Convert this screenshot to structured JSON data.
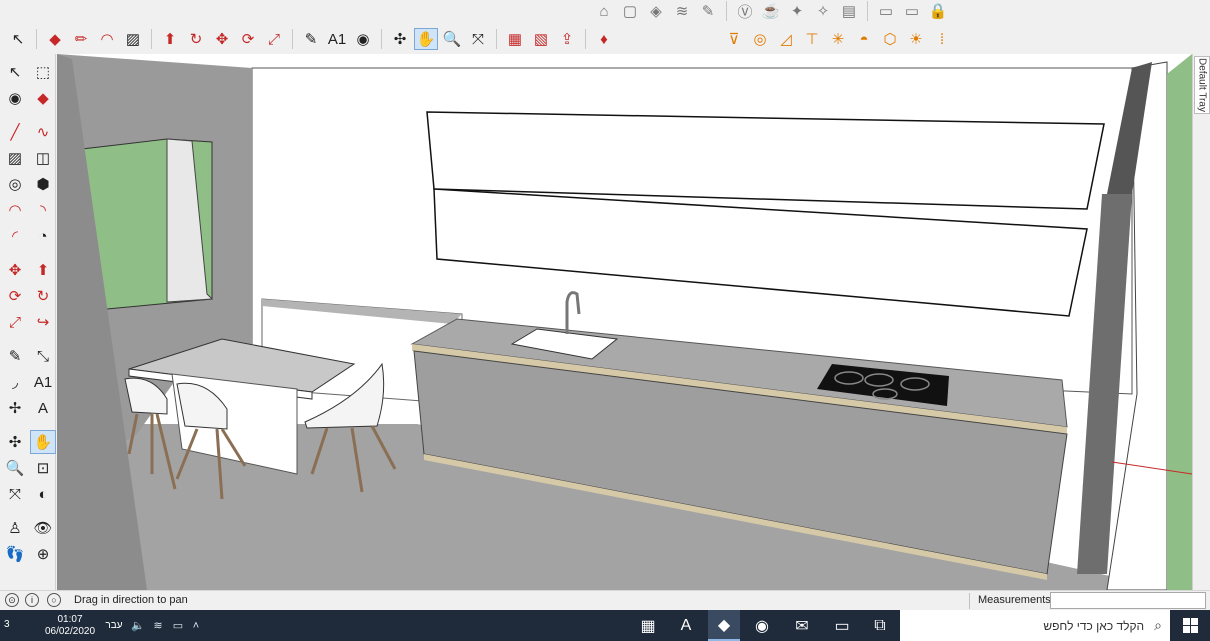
{
  "toolbars": {
    "top_row_right": [
      {
        "name": "styles-sandbox-icon",
        "glyph": "⌂"
      },
      {
        "name": "box-view-icon",
        "glyph": "▢"
      },
      {
        "name": "box-iso-icon",
        "glyph": "◈"
      },
      {
        "name": "grass-icon",
        "glyph": "≋"
      },
      {
        "name": "feather-icon",
        "glyph": "✎"
      },
      {
        "name": "v-circle-icon",
        "glyph": "Ⓥ"
      },
      {
        "name": "teapot-icon",
        "glyph": "☕"
      },
      {
        "name": "paint-icon",
        "glyph": "✦"
      },
      {
        "name": "lamp-icon",
        "glyph": "✧"
      },
      {
        "name": "printer-icon",
        "glyph": "▤"
      },
      {
        "name": "window-icon",
        "glyph": "▭"
      },
      {
        "name": "window2-icon",
        "glyph": "▭"
      },
      {
        "name": "lock-icon",
        "glyph": "🔒"
      }
    ],
    "main_row": [
      {
        "name": "select-tool-icon",
        "glyph": "↖"
      },
      {
        "name": "eraser-tool-icon",
        "glyph": "◆"
      },
      {
        "name": "pencil-tool-icon",
        "glyph": "✏"
      },
      {
        "name": "arc-tool-icon",
        "glyph": "◠"
      },
      {
        "name": "rectangle-tool-icon",
        "glyph": "▨"
      },
      {
        "name": "pushpull-tool-icon",
        "glyph": "⬆"
      },
      {
        "name": "follow-me-tool-icon",
        "glyph": "↻"
      },
      {
        "name": "move-tool-icon",
        "glyph": "✥"
      },
      {
        "name": "rotate-tool-icon",
        "glyph": "⟳"
      },
      {
        "name": "scale-tool-icon",
        "glyph": "⤢"
      },
      {
        "name": "tape-measure-tool-icon",
        "glyph": "✎"
      },
      {
        "name": "text-tool-icon",
        "glyph": "A1"
      },
      {
        "name": "paint-bucket-tool-icon",
        "glyph": "◉"
      },
      {
        "name": "orbit-tool-icon",
        "glyph": "✣"
      },
      {
        "name": "pan-tool-icon",
        "glyph": "✋"
      },
      {
        "name": "zoom-tool-icon",
        "glyph": "🔍"
      },
      {
        "name": "zoom-extents-tool-icon",
        "glyph": "⤧"
      },
      {
        "name": "warehouse-icon",
        "glyph": "▦"
      },
      {
        "name": "extension-warehouse-icon",
        "glyph": "▧"
      },
      {
        "name": "share-model-icon",
        "glyph": "⇪"
      },
      {
        "name": "ruby-icon",
        "glyph": "♦"
      }
    ],
    "sandbox_row": [
      {
        "name": "sandbox-from-contours-icon",
        "glyph": "⊽"
      },
      {
        "name": "sandbox-from-scratch-icon",
        "glyph": "◎"
      },
      {
        "name": "smoove-icon",
        "glyph": "◿"
      },
      {
        "name": "stamp-icon",
        "glyph": "⊤"
      },
      {
        "name": "drape-icon",
        "glyph": "✳"
      },
      {
        "name": "add-detail-icon",
        "glyph": "◓"
      },
      {
        "name": "flip-edge-icon",
        "glyph": "⬡"
      },
      {
        "name": "sun-icon",
        "glyph": "☀"
      },
      {
        "name": "section-icon",
        "glyph": "⦙"
      }
    ],
    "left": [
      {
        "name": "select-icon",
        "glyph": "↖"
      },
      {
        "name": "component-icon",
        "glyph": "⬚"
      },
      {
        "name": "paint-bucket-icon",
        "glyph": "◉"
      },
      {
        "name": "eraser-icon",
        "glyph": "◆"
      },
      {
        "name": "line-icon",
        "glyph": "╱"
      },
      {
        "name": "freehand-icon",
        "glyph": "∿"
      },
      {
        "name": "rectangle-icon",
        "glyph": "▨"
      },
      {
        "name": "rotated-rectangle-icon",
        "glyph": "◫"
      },
      {
        "name": "circle-icon",
        "glyph": "◎"
      },
      {
        "name": "polygon-icon",
        "glyph": "⬢"
      },
      {
        "name": "arc-icon",
        "glyph": "◠"
      },
      {
        "name": "arc2-icon",
        "glyph": "◝"
      },
      {
        "name": "arc3-icon",
        "glyph": "◜"
      },
      {
        "name": "pie-icon",
        "glyph": "◔"
      },
      {
        "name": "move-icon",
        "glyph": "✥"
      },
      {
        "name": "pushpull-icon",
        "glyph": "⬆"
      },
      {
        "name": "rotate-icon",
        "glyph": "⟳"
      },
      {
        "name": "follow-me-icon",
        "glyph": "↻"
      },
      {
        "name": "scale-icon",
        "glyph": "⤢"
      },
      {
        "name": "offset-icon",
        "glyph": "↪"
      },
      {
        "name": "tape-measure-icon",
        "glyph": "✎"
      },
      {
        "name": "dimension-icon",
        "glyph": "⤡"
      },
      {
        "name": "protractor-icon",
        "glyph": "◞"
      },
      {
        "name": "text-icon",
        "glyph": "A1"
      },
      {
        "name": "axes-icon",
        "glyph": "✢"
      },
      {
        "name": "3d-text-icon",
        "glyph": "A"
      },
      {
        "name": "orbit-icon",
        "glyph": "✣"
      },
      {
        "name": "pan-icon",
        "glyph": "✋"
      },
      {
        "name": "zoom-icon",
        "glyph": "🔍"
      },
      {
        "name": "zoom-window-icon",
        "glyph": "⊡"
      },
      {
        "name": "zoom-extents-icon",
        "glyph": "⤧"
      },
      {
        "name": "previous-view-icon",
        "glyph": "◐"
      },
      {
        "name": "position-camera-icon",
        "glyph": "♙"
      },
      {
        "name": "look-around-icon",
        "glyph": "👁"
      },
      {
        "name": "walk-icon",
        "glyph": "👣"
      },
      {
        "name": "section-plane-icon",
        "glyph": "⊕"
      }
    ]
  },
  "tray": {
    "label": "Default Tray"
  },
  "status": {
    "hint": "Drag in direction to pan",
    "measurements_label": "Measurements",
    "measurements_value": ""
  },
  "taskbar": {
    "time": "01:07",
    "date": "06/02/2020",
    "language": "עבר",
    "notification_count": "3",
    "search_placeholder": "הקלד כאן כדי לחפש",
    "apps": [
      {
        "name": "calculator-icon",
        "glyph": "▦"
      },
      {
        "name": "autocad-icon",
        "glyph": "A"
      },
      {
        "name": "sketchup-icon",
        "glyph": "◆"
      },
      {
        "name": "chrome-icon",
        "glyph": "◉"
      },
      {
        "name": "mail-icon",
        "glyph": "✉"
      },
      {
        "name": "file-explorer-icon",
        "glyph": "▭"
      },
      {
        "name": "task-view-icon",
        "glyph": "⧉"
      }
    ]
  },
  "colors": {
    "accent": "#cfe4f7",
    "sky": "#ffffff",
    "wall_gray": "#9a9a9a",
    "floor_gray": "#a3a3a3",
    "counter_gray": "#a9a9a9",
    "grass": "#8fbf86",
    "taskbar": "#1f2a3a"
  }
}
